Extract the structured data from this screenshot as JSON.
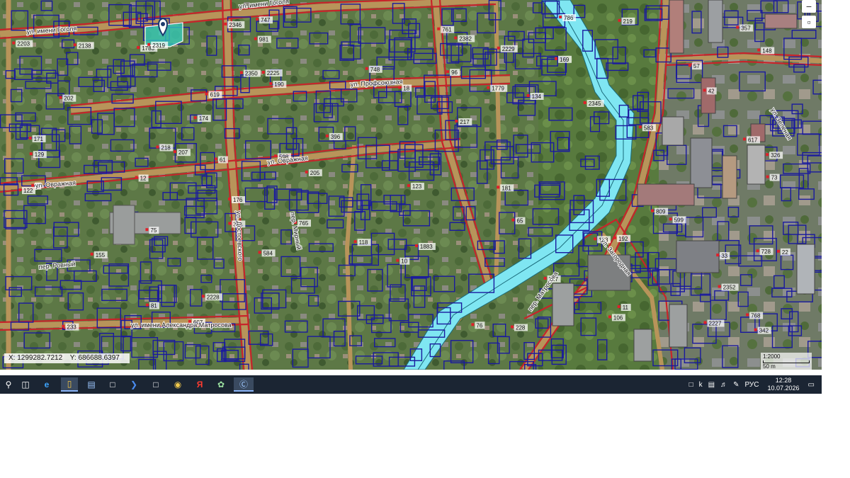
{
  "map": {
    "streets": [
      "ул. имени Гоголя",
      "ул. Профсоюзная",
      "ул. Овражная",
      "ул. Овражная",
      "пер. Ровный",
      "ул. имени Александра Матросова",
      "ул. Достоевского",
      "пер. Мирный",
      "ул. Загородная",
      "пер. Матросова",
      "ул. Зеленая"
    ],
    "parcel_numbers": [
      "190",
      "617",
      "134",
      "326",
      "205",
      "728",
      "765",
      "786",
      "33",
      "57",
      "174",
      "599",
      "583",
      "584",
      "155",
      "123",
      "176",
      "171",
      "747",
      "748",
      "768",
      "96",
      "81",
      "75",
      "217",
      "219",
      "233",
      "217",
      "76",
      "148",
      "607",
      "342",
      "12",
      "761",
      "218",
      "129",
      "73",
      "65",
      "42",
      "809",
      "228",
      "202",
      "118",
      "1883",
      "2352",
      "1783",
      "1779",
      "2345",
      "2225",
      "2228",
      "2227",
      "619",
      "106",
      "169",
      "343",
      "10",
      "18",
      "133",
      "192",
      "181",
      "22",
      "357",
      "396",
      "981",
      "2350",
      "2319",
      "2138",
      "207",
      "2346",
      "2229",
      "2203",
      "8",
      "61",
      "122",
      "11",
      "598",
      "2382"
    ],
    "controls": {
      "zoom_in": "+",
      "zoom_out": "−",
      "layers_icon": "layers-icon"
    },
    "coordinates": {
      "x": "X: 1299282.7212",
      "y": "Y: 686688.6397"
    },
    "scale": {
      "ratio": "1:2000",
      "distance": "50 m"
    }
  },
  "taskbar": {
    "apps": [
      "search-icon",
      "task-view-icon",
      "edge-icon",
      "file-explorer-icon",
      "network-icon",
      "document-icon",
      "powershell-icon",
      "document-icon",
      "yandex-browser-icon",
      "yandex-icon",
      "satellite-icon",
      "active-app-icon"
    ],
    "tray": {
      "language": "РУС"
    },
    "clock": {
      "time": "12:28",
      "date": "10.07.2026"
    }
  },
  "colors": {
    "parcel_border": "#1a1a9e",
    "road_border": "#c8242a",
    "river": "#7fe6f2",
    "selected_parcel": "#34d0c0"
  }
}
